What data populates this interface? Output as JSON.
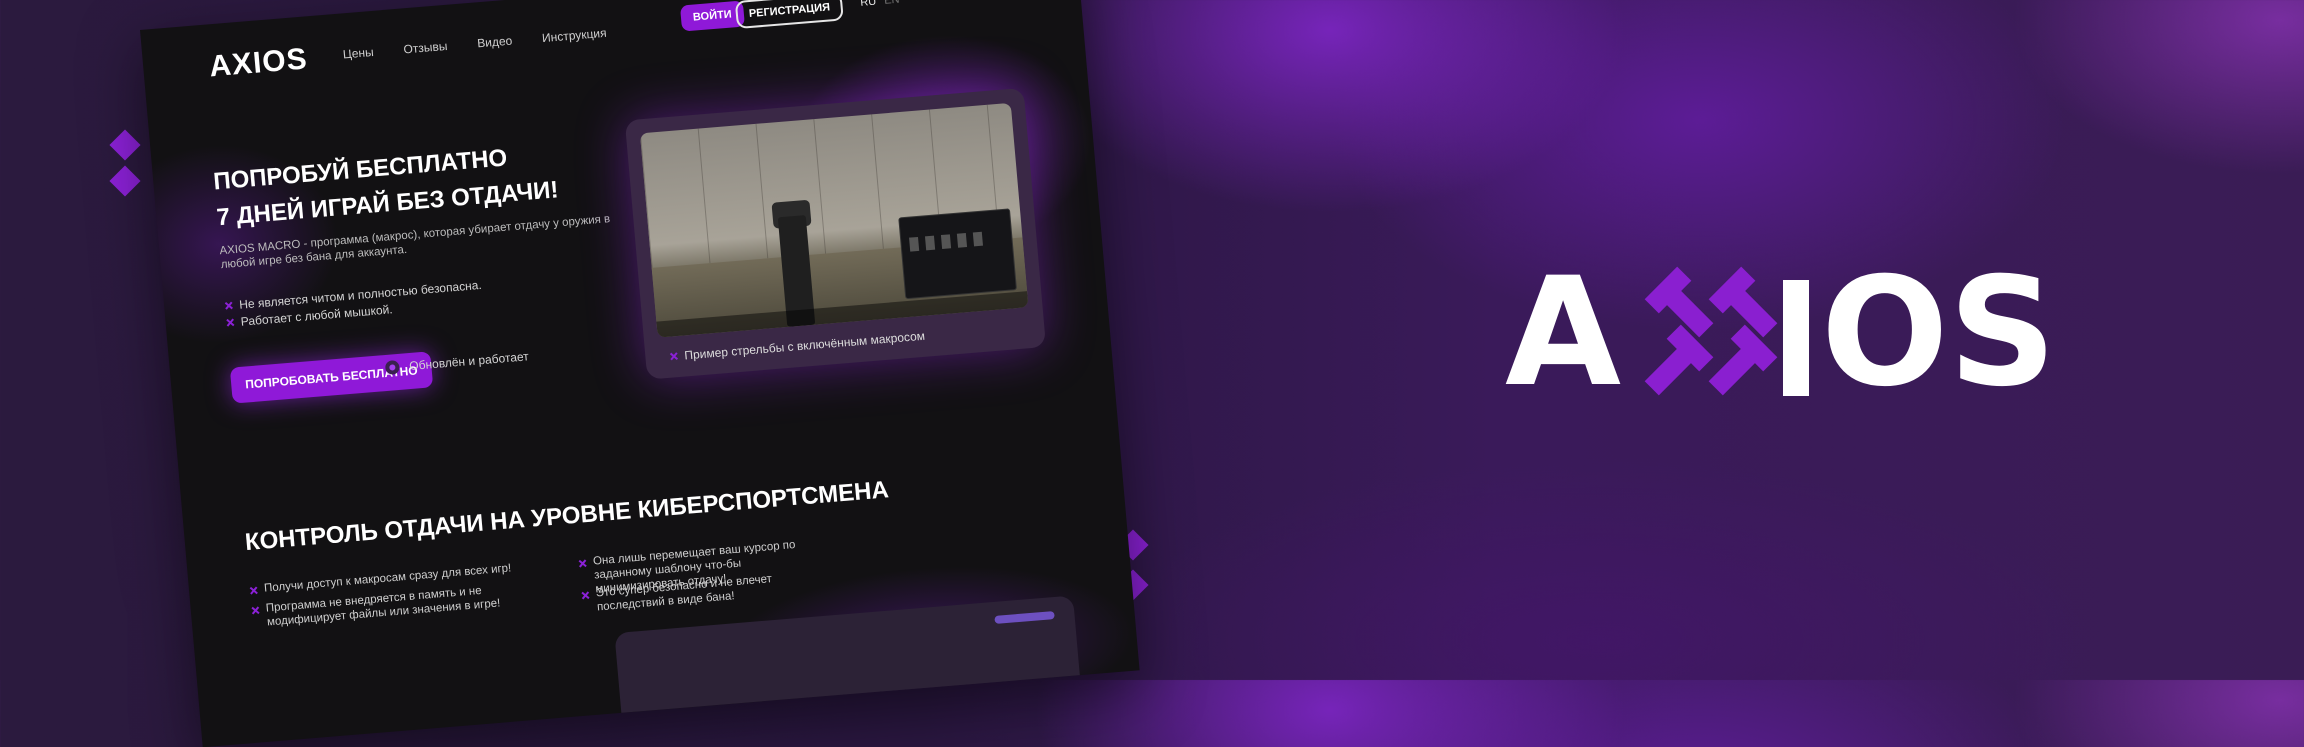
{
  "background": {
    "accent_color": "#8b21d6"
  },
  "mockup": {
    "logo_text": "AXIOS",
    "nav": [
      "Цены",
      "Отзывы",
      "Видео",
      "Инструкция"
    ],
    "login_button": "ВОЙТИ",
    "register_button": "РЕГИСТРАЦИЯ",
    "languages": {
      "ru": "RU",
      "en": "EN"
    },
    "hero": {
      "title_line1": "ПОПРОБУЙ БЕСПЛАТНО",
      "title_line2": "7 ДНЕЙ ИГРАЙ БЕЗ ОТДАЧИ!",
      "description": "AXIOS MACRO - программа (макрос), которая убирает отдачу у оружия в любой игре без бана для аккаунта.",
      "bullets": [
        "Не является читом и полностью безопасна.",
        "Работает с любой мышкой."
      ],
      "try_button": "ПОПРОБОВАТЬ БЕСПЛАТНО",
      "status_text": "Обновлён и работает"
    },
    "video_caption": "Пример стрельбы с включённым макросом",
    "section": {
      "title": "КОНТРОЛЬ ОТДАЧИ НА УРОВНЕ КИБЕРСПОРТСМЕНА",
      "left_features": [
        "Получи доступ к макросам сразу для всех игр!",
        "Программа не внедряется в память и не модифицирует файлы или значения в игре!"
      ],
      "right_features": [
        "Она лишь перемещает ваш курсор по заданному шаблону что-бы минимизировать отдачу!",
        "Это супер безопасно и не влечет последствий в виде бана!"
      ]
    }
  },
  "brand": {
    "logo_text": "AXIOS"
  }
}
